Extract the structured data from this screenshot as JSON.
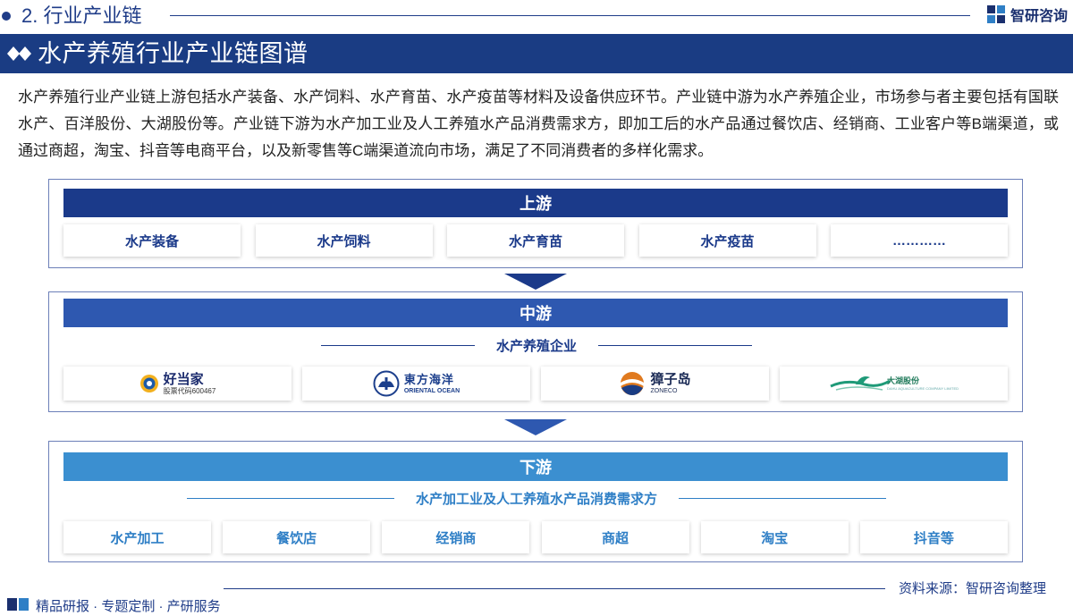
{
  "header": {
    "section_label": "2. 行业产业链",
    "brand": "智研咨询"
  },
  "title": "水产养殖行业产业链图谱",
  "intro": "水产养殖行业产业链上游包括水产装备、水产饲料、水产育苗、水产疫苗等材料及设备供应环节。产业链中游为水产养殖企业，市场参与者主要包括有国联水产、百洋股份、大湖股份等。产业链下游为水产加工业及人工养殖水产品消费需求方，即加工后的水产品通过餐饮店、经销商、工业客户等B端渠道，或通过商超，淘宝、抖音等电商平台，以及新零售等C端渠道流向市场，满足了不同消费者的多样化需求。",
  "upstream": {
    "label": "上游",
    "items": [
      "水产装备",
      "水产饲料",
      "水产育苗",
      "水产疫苗",
      "…………"
    ]
  },
  "midstream": {
    "label": "中游",
    "subtitle": "水产养殖企业",
    "logos": [
      {
        "main": "好当家",
        "sub": "股票代码600467",
        "icon": "haodangjia-logo"
      },
      {
        "main": "東方海洋",
        "sub": "ORIENTAL OCEAN",
        "icon": "oriental-ocean-logo"
      },
      {
        "main": "獐子岛",
        "sub": "ZONECO",
        "icon": "zoneco-logo"
      },
      {
        "main": "大湖股份",
        "sub": "DAHU AQUACULTURE COMPANY LIMITED",
        "icon": "dahu-logo"
      }
    ]
  },
  "downstream": {
    "label": "下游",
    "subtitle": "水产加工业及人工养殖水产品消费需求方",
    "items": [
      "水产加工",
      "餐饮店",
      "经销商",
      "商超",
      "淘宝",
      "抖音等"
    ]
  },
  "footer": {
    "source": "资料来源：智研咨询整理",
    "tagline": "精品研报 · 专题定制 · 产研服务"
  },
  "colors": {
    "navy": "#1a3c83",
    "upstream_head": "#1b3a8a",
    "midstream_head": "#2e58b0",
    "downstream_head": "#3b8fd0",
    "downstream_text": "#2f7fc6"
  }
}
